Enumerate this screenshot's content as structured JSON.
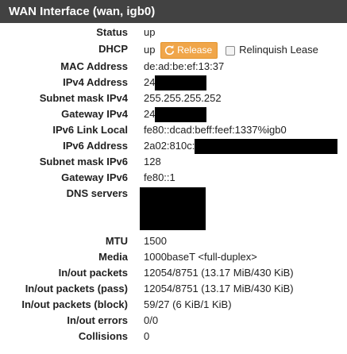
{
  "panel": {
    "title": "WAN Interface (wan, igb0)"
  },
  "fields": [
    {
      "label": "Status",
      "value": "up"
    },
    {
      "label": "DHCP",
      "value": "up",
      "button": "Release",
      "checkbox_label": "Relinquish Lease",
      "checkbox_checked": false
    },
    {
      "label": "MAC Address",
      "value": "de:ad:be:ef:13:37"
    },
    {
      "label": "IPv4 Address",
      "value": "24"
    },
    {
      "label": "Subnet mask IPv4",
      "value": "255.255.255.252"
    },
    {
      "label": "Gateway IPv4",
      "value": "24"
    },
    {
      "label": "IPv6 Link Local",
      "value": "fe80::dcad:beff:feef:1337%igb0"
    },
    {
      "label": "IPv6 Address",
      "value": "2a02:810c:"
    },
    {
      "label": "Subnet mask IPv6",
      "value": "128"
    },
    {
      "label": "Gateway IPv6",
      "value": "fe80::1"
    },
    {
      "label": "DNS servers",
      "value": ""
    },
    {
      "label": "MTU",
      "value": "1500"
    },
    {
      "label": "Media",
      "value": "1000baseT <full-duplex>"
    },
    {
      "label": "In/out packets",
      "value": "12054/8751 (13.17 MiB/430 KiB)"
    },
    {
      "label": "In/out packets (pass)",
      "value": "12054/8751 (13.17 MiB/430 KiB)"
    },
    {
      "label": "In/out packets (block)",
      "value": "59/27 (6 KiB/1 KiB)"
    },
    {
      "label": "In/out errors",
      "value": "0/0"
    },
    {
      "label": "Collisions",
      "value": "0"
    }
  ],
  "icons": {
    "release_button": "refresh-icon"
  },
  "colors": {
    "header_bg": "#424242",
    "release_button": "#f0a64a",
    "redaction": "#000000"
  }
}
